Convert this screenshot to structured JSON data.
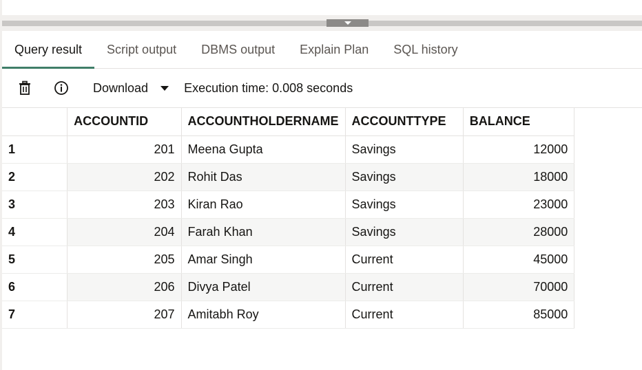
{
  "tabs": [
    {
      "label": "Query result",
      "active": true
    },
    {
      "label": "Script output",
      "active": false
    },
    {
      "label": "DBMS output",
      "active": false
    },
    {
      "label": "Explain Plan",
      "active": false
    },
    {
      "label": "SQL history",
      "active": false
    }
  ],
  "toolbar": {
    "trash_icon": "trash-icon",
    "info_icon": "info-icon",
    "download_label": "Download",
    "execution_time": "Execution time: 0.008 seconds"
  },
  "grid": {
    "columns": [
      "ACCOUNTID",
      "ACCOUNTHOLDERNAME",
      "ACCOUNTTYPE",
      "BALANCE"
    ],
    "rows": [
      {
        "row": "1",
        "ACCOUNTID": "201",
        "ACCOUNTHOLDERNAME": "Meena Gupta",
        "ACCOUNTTYPE": "Savings",
        "BALANCE": "12000"
      },
      {
        "row": "2",
        "ACCOUNTID": "202",
        "ACCOUNTHOLDERNAME": "Rohit Das",
        "ACCOUNTTYPE": "Savings",
        "BALANCE": "18000"
      },
      {
        "row": "3",
        "ACCOUNTID": "203",
        "ACCOUNTHOLDERNAME": "Kiran Rao",
        "ACCOUNTTYPE": "Savings",
        "BALANCE": "23000"
      },
      {
        "row": "4",
        "ACCOUNTID": "204",
        "ACCOUNTHOLDERNAME": "Farah Khan",
        "ACCOUNTTYPE": "Savings",
        "BALANCE": "28000"
      },
      {
        "row": "5",
        "ACCOUNTID": "205",
        "ACCOUNTHOLDERNAME": "Amar Singh",
        "ACCOUNTTYPE": "Current",
        "BALANCE": "45000"
      },
      {
        "row": "6",
        "ACCOUNTID": "206",
        "ACCOUNTHOLDERNAME": "Divya Patel",
        "ACCOUNTTYPE": "Current",
        "BALANCE": "70000"
      },
      {
        "row": "7",
        "ACCOUNTID": "207",
        "ACCOUNTHOLDERNAME": "Amitabh Roy",
        "ACCOUNTTYPE": "Current",
        "BALANCE": "85000"
      }
    ]
  },
  "colors": {
    "active_tab_underline": "#3f7e68",
    "splitter": "#c9c7c5",
    "zebra": "#f6f6f5"
  }
}
